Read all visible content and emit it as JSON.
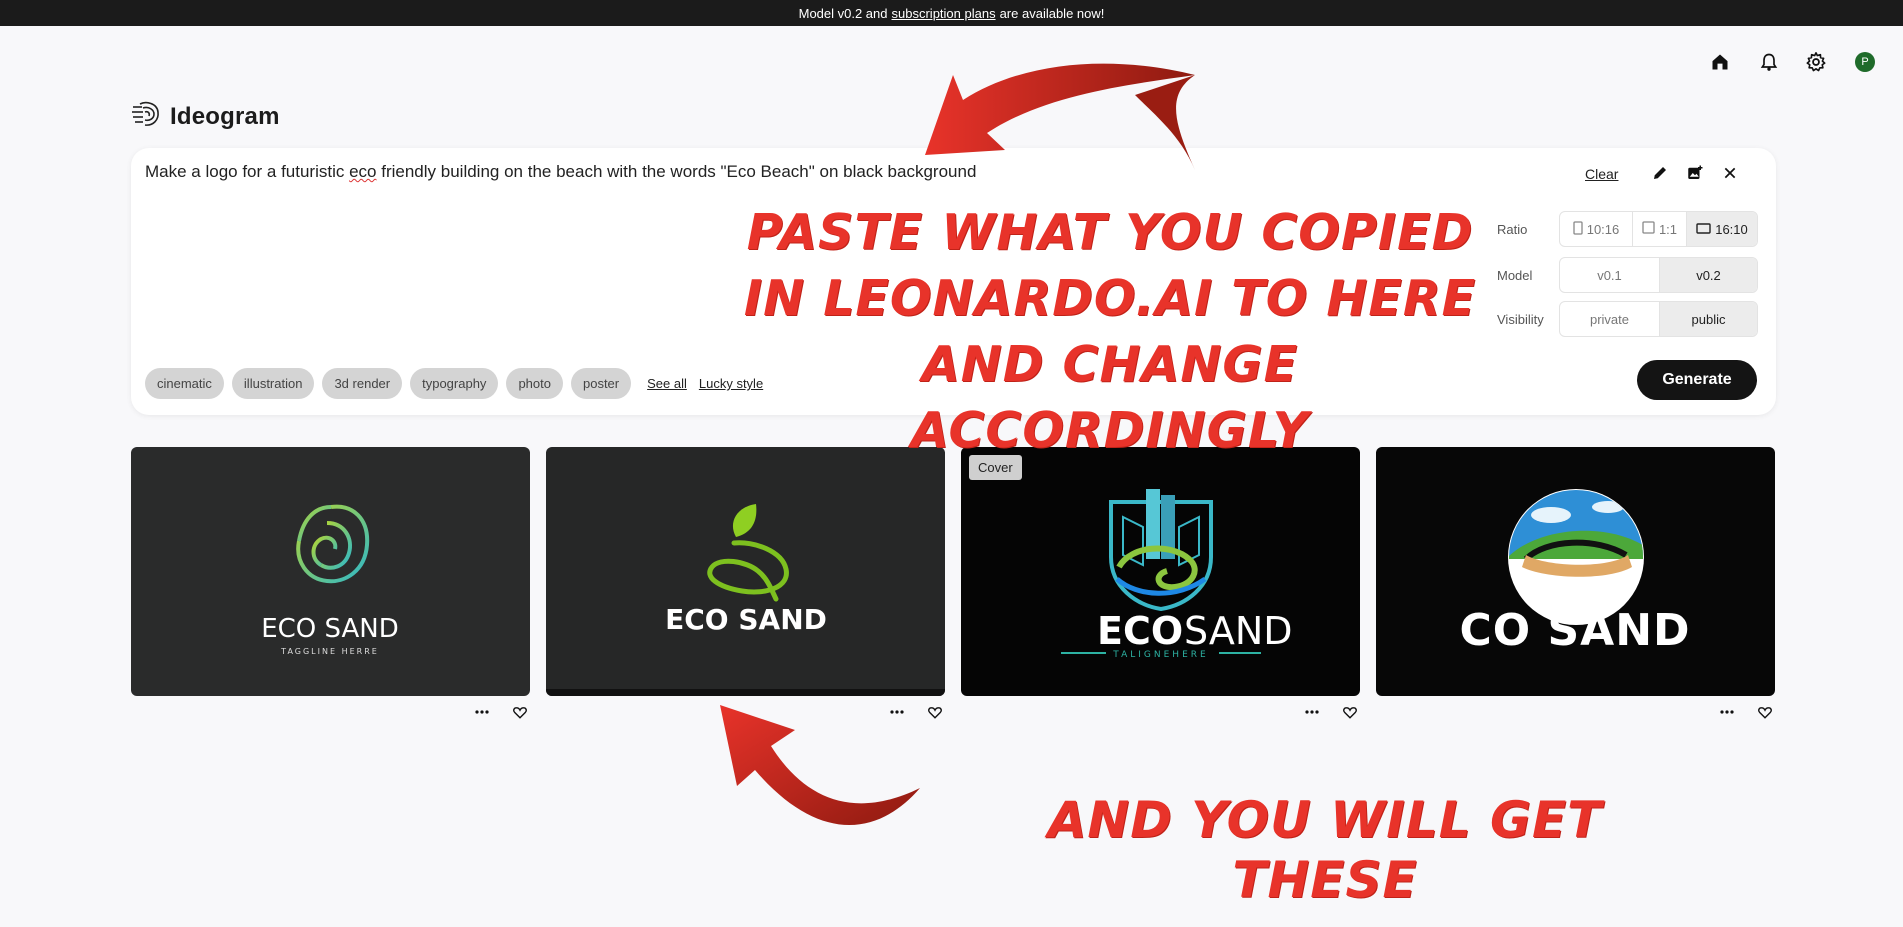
{
  "banner": {
    "prefix": "Model v0.2 and",
    "link": "subscription plans",
    "suffix": "are available now!"
  },
  "header": {
    "avatar_initial": "P",
    "icons": [
      "home-icon",
      "bell-icon",
      "gear-icon"
    ]
  },
  "brand": {
    "name": "Ideogram"
  },
  "prompt": {
    "before": "Make a logo for a futuristic ",
    "misspelled": "eco",
    "after": " friendly building on the beach with the words \"Eco Beach\" on black background",
    "clear_label": "Clear"
  },
  "options": {
    "ratio": {
      "label": "Ratio",
      "choices": [
        "10:16",
        "1:1",
        "16:10"
      ],
      "selected": "16:10"
    },
    "model": {
      "label": "Model",
      "choices": [
        "v0.1",
        "v0.2"
      ],
      "selected": "v0.2"
    },
    "visibility": {
      "label": "Visibility",
      "choices": [
        "private",
        "public"
      ],
      "selected": "public"
    }
  },
  "chips": [
    "cinematic",
    "illustration",
    "3d render",
    "typography",
    "photo",
    "poster"
  ],
  "links": {
    "see_all": "See all",
    "lucky_style": "Lucky style"
  },
  "generate_label": "Generate",
  "results": [
    {
      "title": "ECO SAND",
      "tagline": "TAGGLINE HERRE",
      "bg": "#2a2b2b",
      "badge": ""
    },
    {
      "title": "ECO SAND",
      "tagline": "",
      "bg": "#262727",
      "badge": ""
    },
    {
      "title_a": "ECO",
      "title_b": "SAND",
      "tagline": "TALIGNEHERE",
      "bg": "#050505",
      "badge": "Cover"
    },
    {
      "title": "CO SAND",
      "tagline": "",
      "bg": "#070707",
      "badge": ""
    }
  ],
  "annotations": {
    "top": [
      "PASTE WHAT YOU COPIED",
      "IN LEONARDO.AI TO HERE",
      "AND CHANGE ACCORDINGLY"
    ],
    "bottom": "AND YOU WILL GET THESE",
    "color": "#e8332a"
  }
}
